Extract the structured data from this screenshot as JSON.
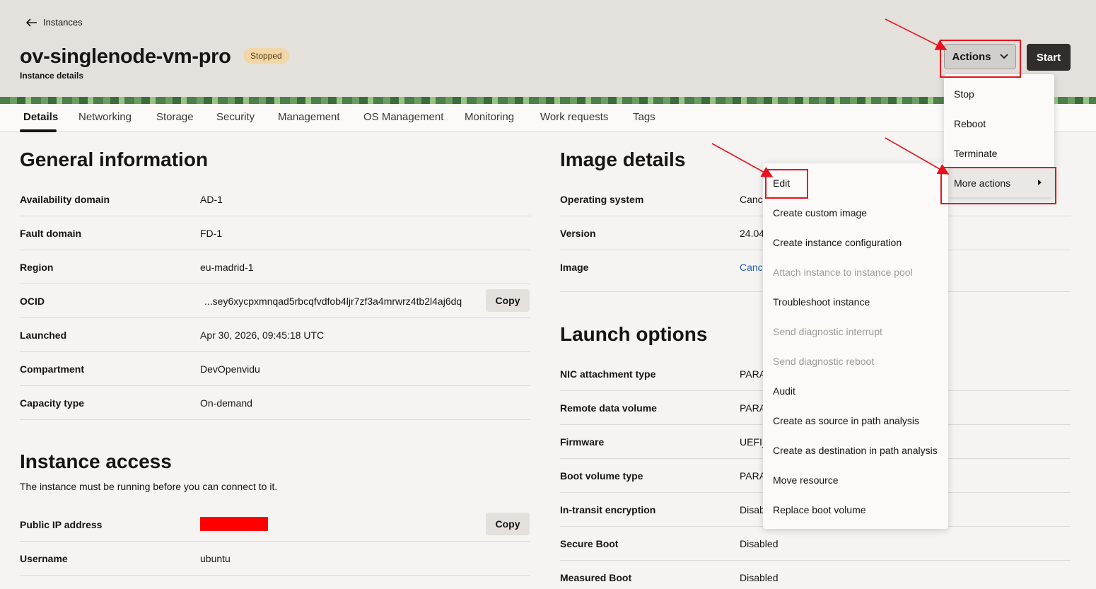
{
  "header": {
    "back_label": "Instances",
    "title": "ov-singlenode-vm-pro",
    "status": "Stopped",
    "subtitle": "Instance details",
    "actions_label": "Actions",
    "start_label": "Start"
  },
  "tabs": [
    "Details",
    "Networking",
    "Storage",
    "Security",
    "Management",
    "OS Management",
    "Monitoring",
    "Work requests",
    "Tags"
  ],
  "general": {
    "heading": "General information",
    "rows": [
      {
        "label": "Availability domain",
        "value": "AD-1"
      },
      {
        "label": "Fault domain",
        "value": "FD-1"
      },
      {
        "label": "Region",
        "value": "eu-madrid-1"
      },
      {
        "label": "OCID",
        "value": "...sey6xycpxmnqad5rbcqfvdfob4ljr7zf3a4mrwrz4tb2l4aj6dq"
      },
      {
        "label": "Launched",
        "value": "Apr 30, 2026, 09:45:18 UTC"
      },
      {
        "label": "Compartment",
        "value": "DevOpenvidu"
      },
      {
        "label": "Capacity type",
        "value": "On-demand"
      }
    ],
    "copy_label": "Copy"
  },
  "access": {
    "heading": "Instance access",
    "description": "The instance must be running before you can connect to it.",
    "rows": [
      {
        "label": "Public IP address",
        "value": ""
      },
      {
        "label": "Username",
        "value": "ubuntu"
      }
    ],
    "copy_label": "Copy"
  },
  "image": {
    "heading": "Image details",
    "rows": [
      {
        "label": "Operating system",
        "value": "Canc"
      },
      {
        "label": "Version",
        "value": "24.04"
      },
      {
        "label": "Image",
        "value": "Canc"
      }
    ]
  },
  "launch": {
    "heading": "Launch options",
    "rows": [
      {
        "label": "NIC attachment type",
        "value": "PARA"
      },
      {
        "label": "Remote data volume",
        "value": "PARA"
      },
      {
        "label": "Firmware",
        "value": "UEFI_"
      },
      {
        "label": "Boot volume type",
        "value": "PARA"
      },
      {
        "label": "In-transit encryption",
        "value": "Disab"
      },
      {
        "label": "Secure Boot",
        "value": "Disabled"
      },
      {
        "label": "Measured Boot",
        "value": "Disabled"
      }
    ]
  },
  "actions_menu": {
    "items": [
      "Stop",
      "Reboot",
      "Terminate",
      "More actions"
    ]
  },
  "more_actions_menu": {
    "items": [
      {
        "label": "Edit",
        "disabled": false
      },
      {
        "label": "Create custom image",
        "disabled": false
      },
      {
        "label": "Create instance configuration",
        "disabled": false
      },
      {
        "label": "Attach instance to instance pool",
        "disabled": true
      },
      {
        "label": "Troubleshoot instance",
        "disabled": false
      },
      {
        "label": "Send diagnostic interrupt",
        "disabled": true
      },
      {
        "label": "Send diagnostic reboot",
        "disabled": true
      },
      {
        "label": "Audit",
        "disabled": false
      },
      {
        "label": "Create as source in path analysis",
        "disabled": false
      },
      {
        "label": "Create as destination in path analysis",
        "disabled": false
      },
      {
        "label": "Move resource",
        "disabled": false
      },
      {
        "label": "Replace boot volume",
        "disabled": false
      }
    ]
  },
  "colors": {
    "annotation_red": "#e8121c",
    "link_blue": "#2360a5",
    "badge_bg": "#f1d6a8"
  }
}
